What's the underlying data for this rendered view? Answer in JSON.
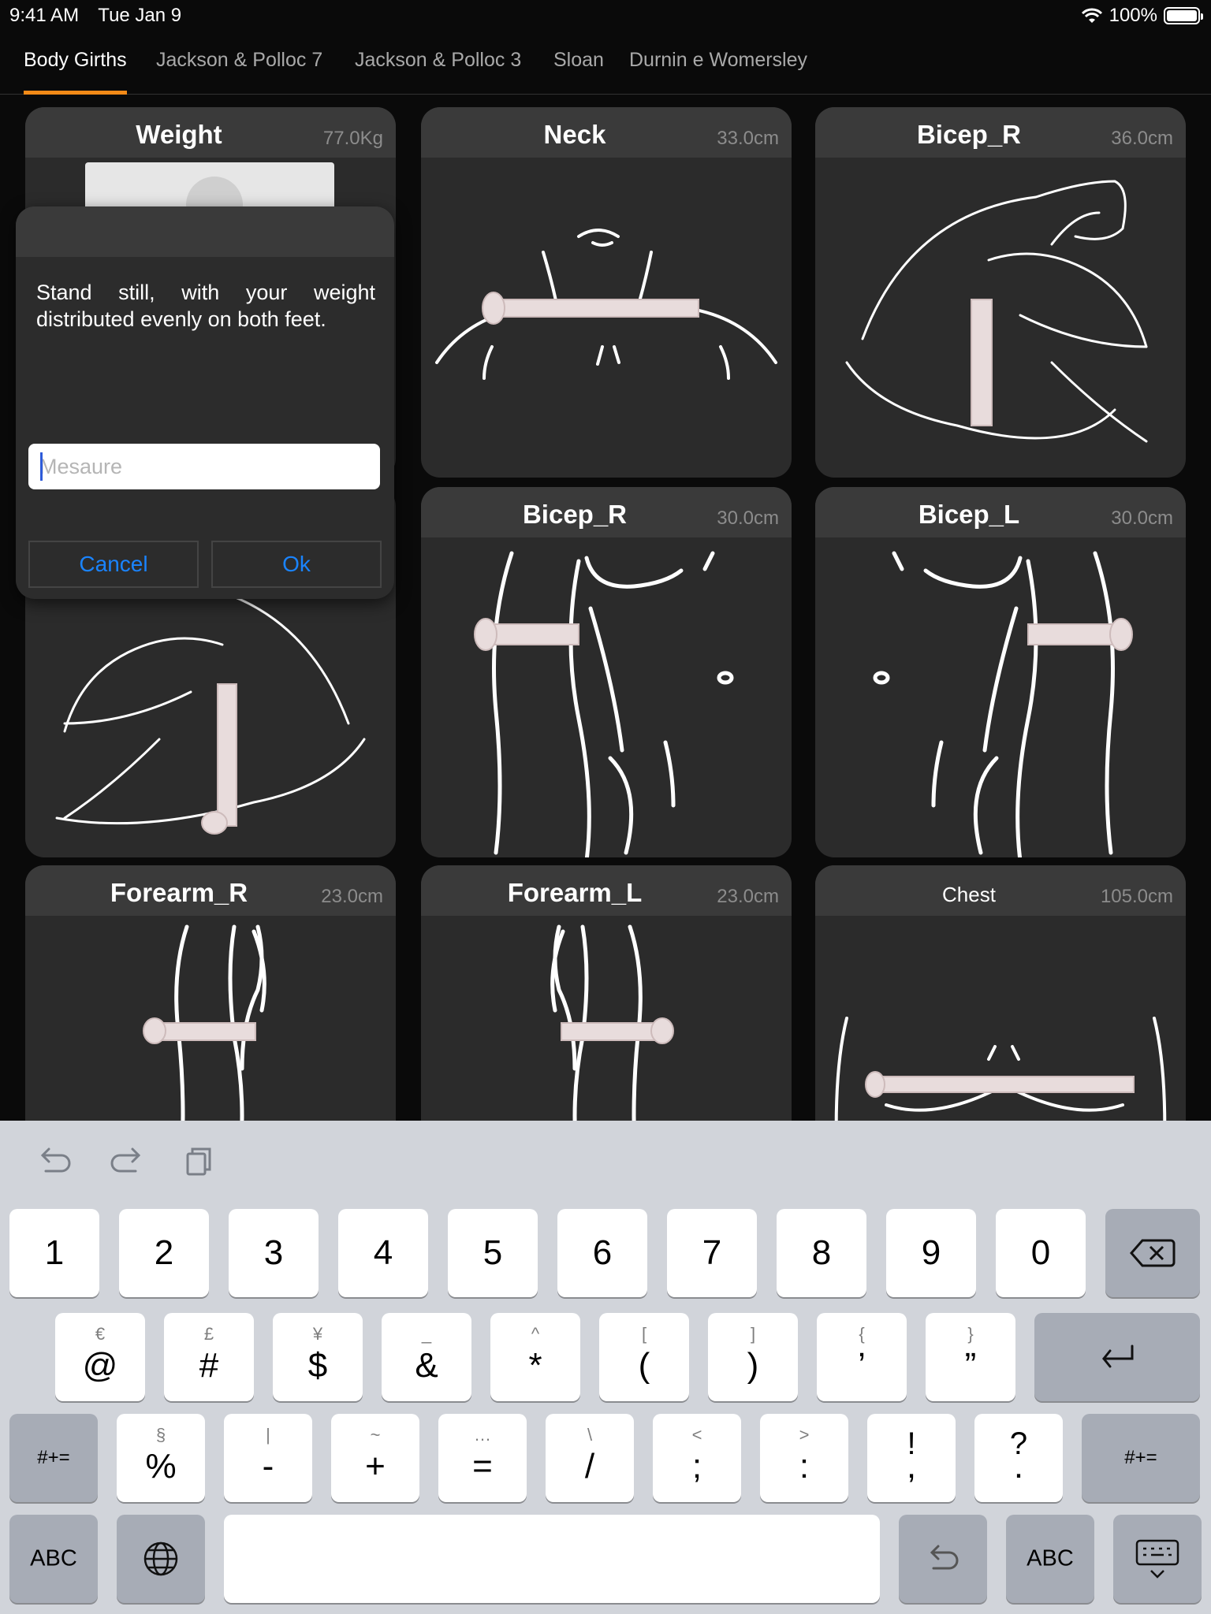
{
  "status": {
    "time": "9:41 AM",
    "date": "Tue Jan 9",
    "battery": "100%"
  },
  "tabs": [
    {
      "label": "Body Girths",
      "active": true
    },
    {
      "label": "Jackson & Polloc 7"
    },
    {
      "label": "Jackson & Polloc 3"
    },
    {
      "label": "Sloan"
    },
    {
      "label": "Durnin e Womersley"
    }
  ],
  "cards": [
    {
      "title": "Weight",
      "value": "77.0Kg"
    },
    {
      "title": "Neck",
      "value": "33.0cm"
    },
    {
      "title": "Bicep_R",
      "value": "36.0cm"
    },
    {
      "title": "Bicep_R",
      "value": "30.0cm"
    },
    {
      "title": "Bicep_L",
      "value": "30.0cm"
    },
    {
      "title": "Forearm_R",
      "value": "23.0cm"
    },
    {
      "title": "Forearm_L",
      "value": "23.0cm"
    },
    {
      "title": "Chest",
      "value": "105.0cm"
    }
  ],
  "dialog": {
    "message": "Stand still, with your weight distributed evenly on both feet.",
    "placeholder": "Mesaure",
    "cancel": "Cancel",
    "ok": "Ok"
  },
  "keyboard": {
    "row1": [
      "1",
      "2",
      "3",
      "4",
      "5",
      "6",
      "7",
      "8",
      "9",
      "0"
    ],
    "row2": [
      {
        "main": "@",
        "alt": "€"
      },
      {
        "main": "#",
        "alt": "£"
      },
      {
        "main": "$",
        "alt": "¥"
      },
      {
        "main": "&",
        "alt": "_"
      },
      {
        "main": "*",
        "alt": "^"
      },
      {
        "main": "(",
        "alt": "["
      },
      {
        "main": ")",
        "alt": "]"
      },
      {
        "main": "’",
        "alt": "{"
      },
      {
        "main": "”",
        "alt": "}"
      }
    ],
    "row3": [
      {
        "main": "%",
        "alt": "§"
      },
      {
        "main": "-",
        "alt": "|"
      },
      {
        "main": "+",
        "alt": "~"
      },
      {
        "main": "=",
        "alt": "…"
      },
      {
        "main": "/",
        "alt": "\\"
      },
      {
        "main": ";",
        "alt": "<"
      },
      {
        "main": ":",
        "alt": ">"
      },
      {
        "main": "!",
        "alt": "!"
      },
      {
        "main": "?",
        "alt": "?"
      }
    ],
    "row3_extra": [
      ",",
      "."
    ],
    "symbols_left": "#+=",
    "symbols_right": "#+=",
    "abc_left": "ABC",
    "abc_right": "ABC"
  }
}
